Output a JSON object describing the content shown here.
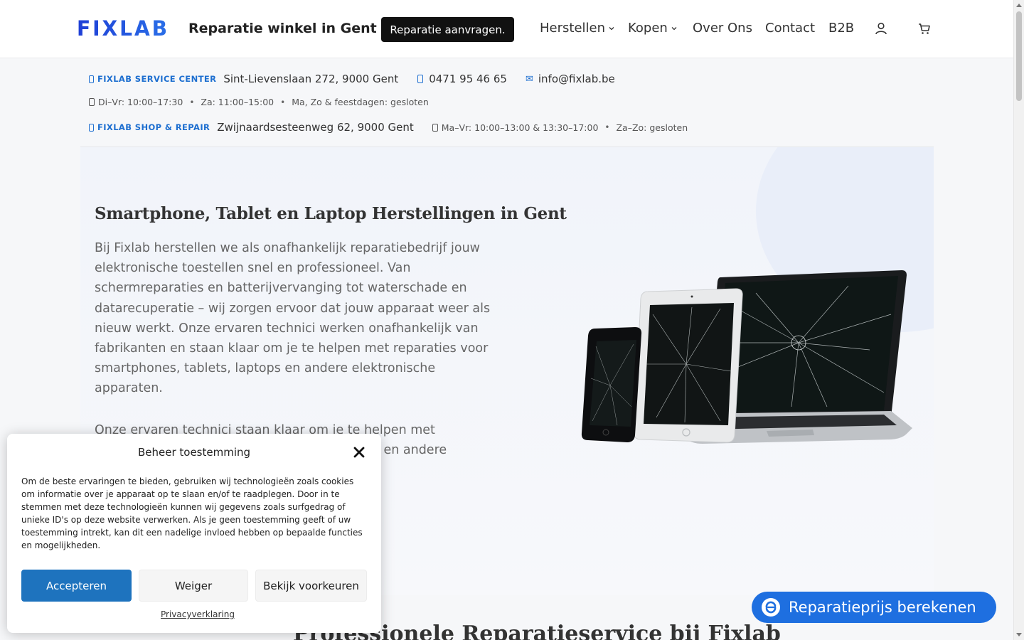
{
  "header": {
    "logo_text": "FIXLAB",
    "tagline": "Reparatie winkel in Gent",
    "cta_label": "Reparatie aanvragen.",
    "nav": [
      {
        "label": "Herstellen",
        "dropdown": true
      },
      {
        "label": "Kopen",
        "dropdown": true
      },
      {
        "label": "Over Ons",
        "dropdown": false
      },
      {
        "label": "Contact",
        "dropdown": false
      },
      {
        "label": "B2B",
        "dropdown": false
      }
    ],
    "icons": [
      "user-icon",
      "cart-icon"
    ]
  },
  "info": {
    "service_center": {
      "label": "FIXLAB SERVICE CENTER",
      "address": "Sint-Lievenslaan 272, 9000 Gent",
      "phone": "0471 95 46 65",
      "email": "info@fixlab.be",
      "hours": [
        "Di–Vr: 10:00–17:30",
        "Za: 11:00–15:00",
        "Ma, Zo & feestdagen: gesloten"
      ]
    },
    "shop": {
      "label": "FIXLAB SHOP & REPAIR",
      "address": "Zwijnaardsesteenweg 62, 9000 Gent",
      "hours": [
        "Ma–Vr: 10:00–13:00 & 13:30–17:00",
        "Za–Zo: gesloten"
      ]
    }
  },
  "hero": {
    "title": "Smartphone, Tablet en Laptop Herstellingen in Gent",
    "paragraph1": "Bij Fixlab herstellen we als onafhankelijk reparatiebedrijf jouw elektronische toestellen snel en professioneel. Van schermreparaties en batterijvervanging tot waterschade en datarecuperatie – wij zorgen ervoor dat jouw apparaat weer als nieuw werkt. Onze ervaren technici werken onafhankelijk van fabrikanten en staan klaar om je te helpen met reparaties voor smartphones, tablets, laptops en andere elektronische apparaten.",
    "paragraph2": "Onze ervaren technici staan klaar om je te helpen met reparaties voor smartphones, tablets, laptops en andere"
  },
  "section_title": "Professionele Reparatieservice bij Fixlab",
  "cookie": {
    "title": "Beheer toestemming",
    "text": "Om de beste ervaringen te bieden, gebruiken wij technologieën zoals cookies om informatie over je apparaat op te slaan en/of te raadplegen. Door in te stemmen met deze technologieën kunnen wij gegevens zoals surfgedrag of unieke ID's op deze website verwerken. Als je geen toestemming geeft of uw toestemming intrekt, kan dit een nadelige invloed hebben op bepaalde functies en mogelijkheden.",
    "accept": "Accepteren",
    "deny": "Weiger",
    "preferences": "Bekijk voorkeuren",
    "privacy_link": "Privacyverklaring"
  },
  "fab": {
    "label": "Reparatieprijs berekenen"
  },
  "colors": {
    "brand_blue": "#1e6fd0",
    "accept_blue": "#1e73be",
    "fab_blue": "#1e6fe0"
  }
}
